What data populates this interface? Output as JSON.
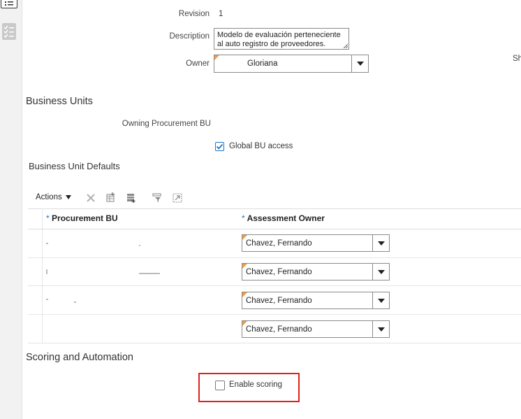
{
  "general": {
    "revision_label": "Revision",
    "revision_value": "1",
    "description_label": "Description",
    "description_value": "Modelo de evaluación perteneciente al auto registro de proveedores.",
    "owner_label": "Owner",
    "owner_value": "Gloriana",
    "cut_label_right": "Sh"
  },
  "business_units": {
    "heading": "Business Units",
    "owning_bu_label": "Owning Procurement BU",
    "global_access_label": "Global BU access",
    "global_access_checked": true
  },
  "defaults": {
    "heading": "Business Unit Defaults",
    "actions_label": "Actions",
    "columns": [
      "Procurement BU",
      "Assessment Owner"
    ],
    "rows": [
      {
        "procurement_bu": "",
        "assessment_owner": "Chavez, Fernando"
      },
      {
        "procurement_bu": "",
        "assessment_owner": "Chavez, Fernando"
      },
      {
        "procurement_bu": "",
        "assessment_owner": "Chavez, Fernando"
      },
      {
        "procurement_bu": "",
        "assessment_owner": "Chavez, Fernando"
      }
    ]
  },
  "scoring": {
    "heading": "Scoring and Automation",
    "enable_scoring_label": "Enable scoring",
    "enable_scoring_checked": false,
    "highlight_color": "#e0201b"
  },
  "colors": {
    "required_marker": "#f29a4a",
    "checkbox_checked": "#1a73c9"
  }
}
